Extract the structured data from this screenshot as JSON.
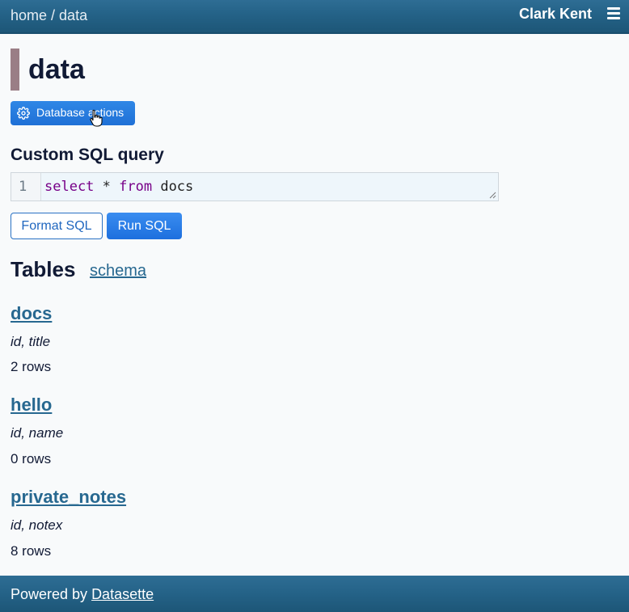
{
  "header": {
    "crumb_home": "home",
    "crumb_sep": " / ",
    "crumb_current": "data",
    "user": "Clark Kent"
  },
  "page": {
    "title": "data",
    "db_actions_label": "Database actions"
  },
  "sql": {
    "heading": "Custom SQL query",
    "line_number": "1",
    "kw_select": "select",
    "op": " * ",
    "kw_from": "from",
    "table": " docs",
    "format_label": "Format SQL",
    "run_label": "Run SQL"
  },
  "tables": {
    "heading": "Tables",
    "schema_link": "schema",
    "items": [
      {
        "name": "docs",
        "columns": "id, title",
        "rows": "2 rows"
      },
      {
        "name": "hello",
        "columns": "id, name",
        "rows": "0 rows"
      },
      {
        "name": "private_notes",
        "columns": "id, notex",
        "rows": "8 rows"
      }
    ]
  },
  "footer": {
    "powered_by": "Powered by ",
    "datasette": "Datasette"
  },
  "colors": {
    "header_bg": "#246287",
    "accent_button": "#1f70d6",
    "link": "#276890",
    "title_bar": "#9a7e86"
  },
  "icons": [
    "menu-icon",
    "gear-icon",
    "pointer-cursor-icon",
    "resize-handle-icon"
  ]
}
